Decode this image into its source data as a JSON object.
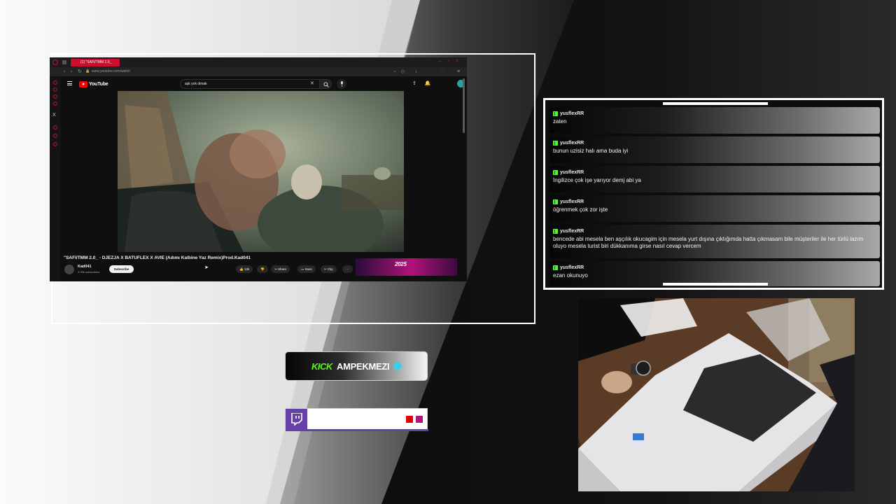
{
  "colors": {
    "kick_green": "#53fc18",
    "twitch_purple": "#6441a5",
    "youtube_red": "#ff0000",
    "browser_accent": "#c8102e"
  },
  "browser": {
    "tab_title": "(1) \"SAFI/TMM 2.0_",
    "url": "www.youtube.com/watch",
    "youtube": {
      "logo_text": "YouTube",
      "search_value": "aşk yok olmak",
      "video_title": "\"SAFI/TMM 2.0_ - DJEZJA X BATUFLEX X AVIE (Adımı Kalbine Yaz Remix)Prod.Kad041",
      "channel_name": "Kad041",
      "channel_subs": "3.33k subscribers",
      "subscribe_label": "Subscribe",
      "like_count": "13k",
      "share_label": "Share",
      "save_label": "Save",
      "clip_label": "Clip",
      "more_label": "···",
      "ad_text": "2025"
    }
  },
  "chat": {
    "messages": [
      {
        "user": "yusflexRR",
        "text": "zaten"
      },
      {
        "user": "yusflexRR",
        "text": "bunun uzisiz halı ama buda iyi"
      },
      {
        "user": "yusflexRR",
        "text": "İngilizce çok işe yarıyor demj abi ya"
      },
      {
        "user": "yusflexRR",
        "text": "öğrenmek çok zor işte"
      },
      {
        "user": "yusflexRR",
        "text": "bencede abi mesela ben aşçılık okucagim için mesela yurt dışına çıktığımda hatta çıkmasam bile müşteriler ile her türlü lazım oluyo mesela turist biri dükkanıma girse nasıl cevap vercem"
      },
      {
        "user": "yusflexRR",
        "text": "ezan okunuyo"
      }
    ]
  },
  "kick": {
    "platform": "KICK",
    "username": "AMPEKMEZI"
  },
  "twitch": {
    "icon": "twitch-icon",
    "square_colors": [
      "#e00000",
      "#b0177a"
    ]
  }
}
